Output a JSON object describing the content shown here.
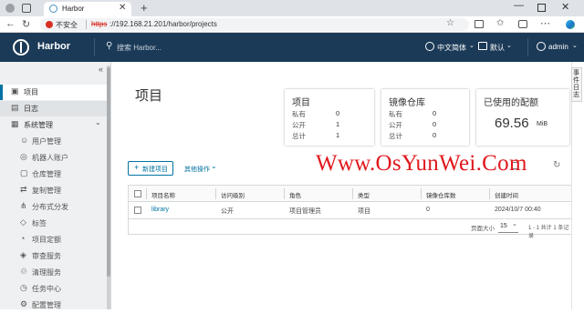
{
  "browser": {
    "tab_title": "Harbor",
    "insecure_label": "不安全",
    "url_scheme": "https",
    "url_rest": "://192.168.21.201/harbor/projects"
  },
  "header": {
    "brand": "Harbor",
    "search_placeholder": "搜索 Harbor...",
    "language": "中文简体",
    "theme": "默认",
    "user": "admin"
  },
  "sidebar": {
    "items": [
      {
        "label": "项目",
        "icon": "projects-icon",
        "active": true
      },
      {
        "label": "日志",
        "icon": "logs-icon"
      },
      {
        "label": "系统管理",
        "icon": "admin-icon",
        "expanded": true
      },
      {
        "label": "用户管理",
        "icon": "users-icon"
      },
      {
        "label": "机器人账户",
        "icon": "robot-icon"
      },
      {
        "label": "仓库管理",
        "icon": "registry-icon"
      },
      {
        "label": "复制管理",
        "icon": "replication-icon"
      },
      {
        "label": "分布式分发",
        "icon": "distribution-icon"
      },
      {
        "label": "标签",
        "icon": "tag-icon"
      },
      {
        "label": "项目定额",
        "icon": "quota-icon"
      },
      {
        "label": "审查服务",
        "icon": "scanner-icon"
      },
      {
        "label": "清理服务",
        "icon": "cleanup-icon"
      },
      {
        "label": "任务中心",
        "icon": "jobs-icon"
      },
      {
        "label": "配置管理",
        "icon": "config-icon"
      }
    ]
  },
  "right_tab_label": "事件日志",
  "page_title": "项目",
  "cards": {
    "projects": {
      "title": "项目",
      "rows": [
        {
          "label": "私有",
          "value": "0"
        },
        {
          "label": "公开",
          "value": "1"
        },
        {
          "label": "总计",
          "value": "1"
        }
      ]
    },
    "repositories": {
      "title": "镜像仓库",
      "rows": [
        {
          "label": "私有",
          "value": "0"
        },
        {
          "label": "公开",
          "value": "0"
        },
        {
          "label": "总计",
          "value": "0"
        }
      ]
    },
    "quota": {
      "title": "已使用的配额",
      "value": "69.56",
      "unit": "MiB"
    }
  },
  "actions": {
    "new_project": "新建项目",
    "other_actions": "其他操作"
  },
  "table": {
    "headers": [
      "项目名称",
      "访问级别",
      "角色",
      "类型",
      "镜像仓库数",
      "创建时间"
    ],
    "rows": [
      [
        "library",
        "公开",
        "项目管理员",
        "项目",
        "0",
        "2024/10/7 00:40"
      ]
    ],
    "page_size_label": "页面大小",
    "page_size": "15",
    "pagination_text": "1 - 1 共计 1 条记录"
  },
  "watermark": "Www.OsYunWei.Com",
  "colors": {
    "header_bg": "#1b3a57",
    "accent": "#0072a3",
    "watermark": "#e0181e",
    "sidebar_bg": "#eef0f2"
  }
}
